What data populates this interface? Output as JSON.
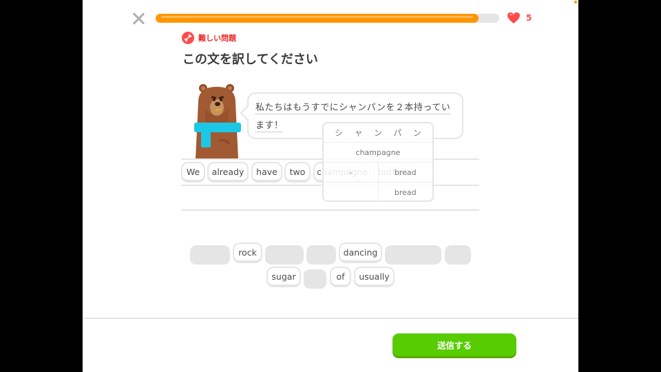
{
  "progress": {
    "value": 0.94
  },
  "hearts": {
    "count": "5"
  },
  "header": {
    "badge_label": "難しい問題",
    "title": "この文を訳してください"
  },
  "prompt": {
    "sentence": "私たちはもうすでにシャンパンを２本持っています！"
  },
  "answer_words": [
    "We",
    "already",
    "have",
    "two",
    "champagne",
    "bottles"
  ],
  "hint": {
    "header_chars": [
      "シ",
      "ャ",
      "ン",
      "パ",
      "ン"
    ],
    "rows": [
      [
        "champagne"
      ],
      [
        "-",
        "bread"
      ],
      [
        "",
        "bread"
      ]
    ]
  },
  "word_bank": [
    "rock",
    "dancing",
    "sugar",
    "of",
    "usually"
  ],
  "footer": {
    "submit_label": "送信する"
  },
  "colors": {
    "accent_green": "#58cc02",
    "progress_orange": "#ff9600",
    "heart_red": "#ff4b4b"
  }
}
